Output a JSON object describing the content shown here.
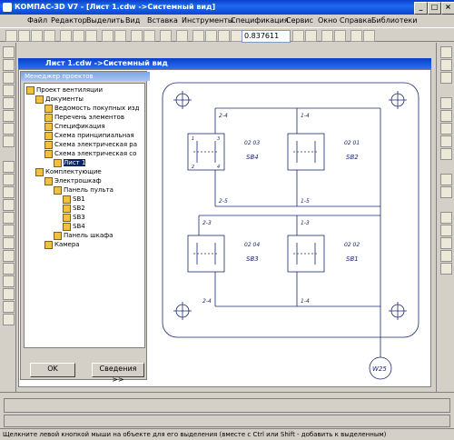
{
  "window": {
    "title": "КОМПАС-3D V7 - [Лист 1.cdw ->Системный вид]"
  },
  "menu": [
    "Файл",
    "Редактор",
    "Выделить",
    "Вид",
    "Вставка",
    "Инструменты",
    "Спецификация",
    "Сервис",
    "Окно",
    "Справка",
    "Библиотеки"
  ],
  "toolbar": {
    "zoom_value": "0.837611"
  },
  "document": {
    "tab_title": "Лист 1.cdw ->Системный вид"
  },
  "project_manager": {
    "title": "Менеджер проектов",
    "tree": [
      {
        "label": "Проект вентиляции",
        "level": 0
      },
      {
        "label": "Документы",
        "level": 1
      },
      {
        "label": "Ведомость покупных изд",
        "level": 2
      },
      {
        "label": "Перечень элементов",
        "level": 2
      },
      {
        "label": "Спецификация",
        "level": 2
      },
      {
        "label": "Схема принципиальная",
        "level": 2
      },
      {
        "label": "Схема электрическая ра",
        "level": 2
      },
      {
        "label": "Схема электрическая со",
        "level": 2
      },
      {
        "label": "Лист 1",
        "level": 3,
        "selected": true
      },
      {
        "label": "Комплектующие",
        "level": 1
      },
      {
        "label": "Электрошкаф",
        "level": 2
      },
      {
        "label": "Панель пульта",
        "level": 3
      },
      {
        "label": "SB1",
        "level": 4
      },
      {
        "label": "SB2",
        "level": 4
      },
      {
        "label": "SB3",
        "level": 4
      },
      {
        "label": "SB4",
        "level": 4
      },
      {
        "label": "Панель шкафа",
        "level": 3
      },
      {
        "label": "Камера",
        "level": 2
      }
    ],
    "ok_label": "OK",
    "info_label": "Сведения >>"
  },
  "drawing": {
    "switches": [
      {
        "pos": "02 03",
        "name": "SB4",
        "top_wire": "2-4",
        "bottom_wire": "2-5"
      },
      {
        "pos": "02 01",
        "name": "SB2",
        "top_wire": "1-4",
        "bottom_wire": "1-5"
      },
      {
        "pos": "02 04",
        "name": "SB3",
        "top_wire": "2-3",
        "bottom_wire": "2-4"
      },
      {
        "pos": "02 02",
        "name": "SB1",
        "top_wire": "1-3",
        "bottom_wire": "1-4"
      }
    ],
    "contact_top": [
      "1",
      "3"
    ],
    "contact_bottom": [
      "2",
      "4"
    ],
    "cable_label": "W25"
  },
  "status_bar": {
    "text": "Щелкните левой кнопкой мыши на объекте для его выделения (вместе с Ctrl или Shift - добавить к выделенным)"
  }
}
